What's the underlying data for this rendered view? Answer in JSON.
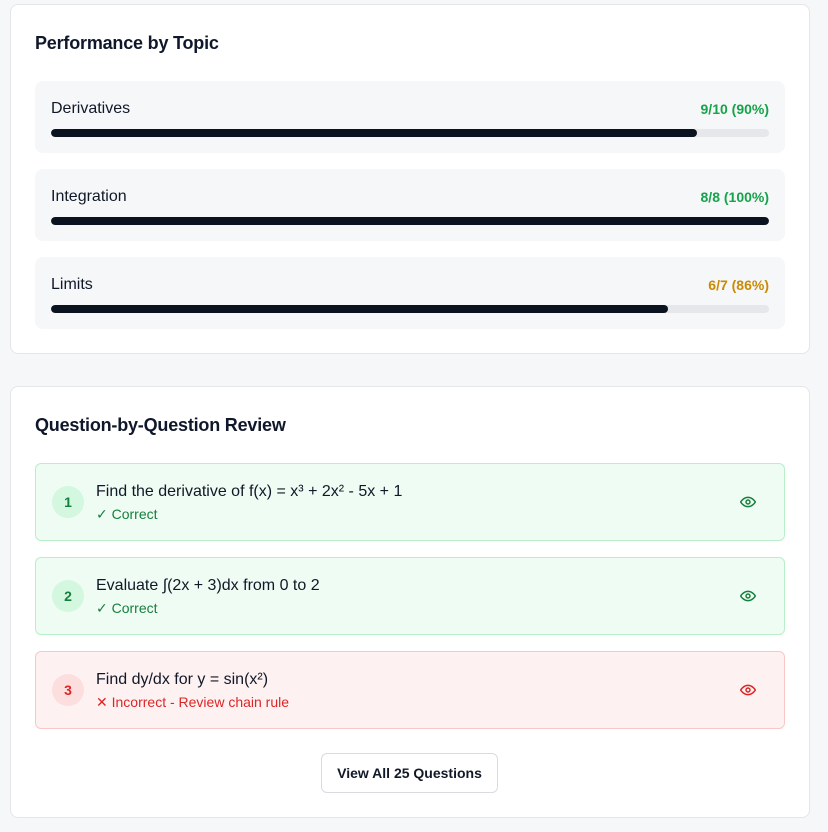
{
  "topics_section": {
    "title": "Performance by Topic",
    "items": [
      {
        "name": "Derivatives",
        "score": "9/10 (90%)",
        "fraction": 0.9,
        "score_color": "#16a34a"
      },
      {
        "name": "Integration",
        "score": "8/8 (100%)",
        "fraction": 1.0,
        "score_color": "#16a34a"
      },
      {
        "name": "Limits",
        "score": "6/7 (86%)",
        "fraction": 0.86,
        "score_color": "#ca8a04"
      }
    ],
    "bar_color": "#0b1220",
    "track_color": "#e5e7eb"
  },
  "review_section": {
    "title": "Question-by-Question Review",
    "questions": [
      {
        "number": "1",
        "text": "Find the derivative of f(x) = x³ + 2x² - 5x + 1",
        "status": "✓ Correct",
        "state": "correct",
        "icon": "eye-icon"
      },
      {
        "number": "2",
        "text": "Evaluate ∫(2x + 3)dx from 0 to 2",
        "status": "✓ Correct",
        "state": "correct",
        "icon": "eye-icon"
      },
      {
        "number": "3",
        "text": "Find dy/dx for y = sin(x²)",
        "status": "✕ Incorrect - Review chain rule",
        "state": "incorrect",
        "icon": "eye-icon"
      }
    ],
    "view_all_label": "View All 25 Questions",
    "colors": {
      "correct": "#15803d",
      "incorrect": "#dc2626"
    }
  }
}
